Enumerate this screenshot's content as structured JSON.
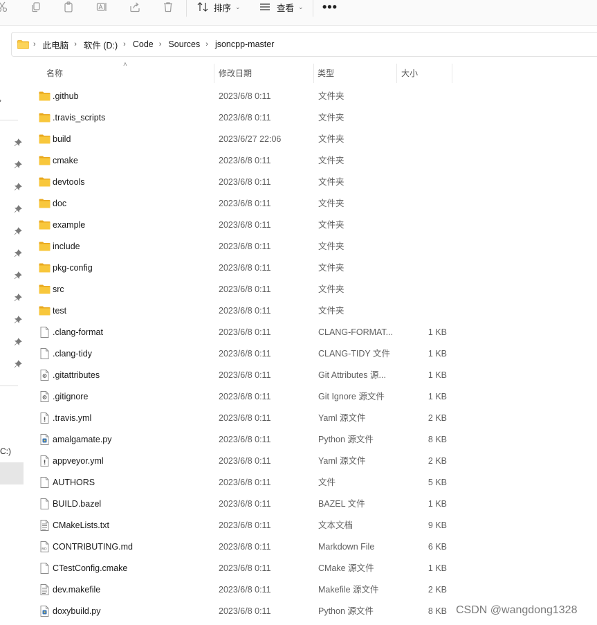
{
  "toolbar": {
    "sort_label": "排序",
    "view_label": "查看",
    "more_label": "•••"
  },
  "address": {
    "crumbs": [
      "此电脑",
      "软件 (D:)",
      "Code",
      "Sources",
      "jsoncpp-master"
    ]
  },
  "left_pane": {
    "drive_fragment": "C:)"
  },
  "columns": {
    "name": "名称",
    "date": "修改日期",
    "type": "类型",
    "size": "大小"
  },
  "files": [
    {
      "name": ".github",
      "date": "2023/6/8 0:11",
      "type": "文件夹",
      "size": "",
      "icon": "folder-icon"
    },
    {
      "name": ".travis_scripts",
      "date": "2023/6/8 0:11",
      "type": "文件夹",
      "size": "",
      "icon": "folder-icon"
    },
    {
      "name": "build",
      "date": "2023/6/27 22:06",
      "type": "文件夹",
      "size": "",
      "icon": "folder-icon"
    },
    {
      "name": "cmake",
      "date": "2023/6/8 0:11",
      "type": "文件夹",
      "size": "",
      "icon": "folder-icon"
    },
    {
      "name": "devtools",
      "date": "2023/6/8 0:11",
      "type": "文件夹",
      "size": "",
      "icon": "folder-icon"
    },
    {
      "name": "doc",
      "date": "2023/6/8 0:11",
      "type": "文件夹",
      "size": "",
      "icon": "folder-icon"
    },
    {
      "name": "example",
      "date": "2023/6/8 0:11",
      "type": "文件夹",
      "size": "",
      "icon": "folder-icon"
    },
    {
      "name": "include",
      "date": "2023/6/8 0:11",
      "type": "文件夹",
      "size": "",
      "icon": "folder-icon"
    },
    {
      "name": "pkg-config",
      "date": "2023/6/8 0:11",
      "type": "文件夹",
      "size": "",
      "icon": "folder-icon"
    },
    {
      "name": "src",
      "date": "2023/6/8 0:11",
      "type": "文件夹",
      "size": "",
      "icon": "folder-icon"
    },
    {
      "name": "test",
      "date": "2023/6/8 0:11",
      "type": "文件夹",
      "size": "",
      "icon": "folder-icon"
    },
    {
      "name": ".clang-format",
      "date": "2023/6/8 0:11",
      "type": "CLANG-FORMAT...",
      "size": "1 KB",
      "icon": "file-icon"
    },
    {
      "name": ".clang-tidy",
      "date": "2023/6/8 0:11",
      "type": "CLANG-TIDY 文件",
      "size": "1 KB",
      "icon": "file-icon"
    },
    {
      "name": ".gitattributes",
      "date": "2023/6/8 0:11",
      "type": "Git Attributes 源...",
      "size": "1 KB",
      "icon": "gear-file-icon"
    },
    {
      "name": ".gitignore",
      "date": "2023/6/8 0:11",
      "type": "Git Ignore 源文件",
      "size": "1 KB",
      "icon": "gear-file-icon"
    },
    {
      "name": ".travis.yml",
      "date": "2023/6/8 0:11",
      "type": "Yaml 源文件",
      "size": "2 KB",
      "icon": "yaml-file-icon"
    },
    {
      "name": "amalgamate.py",
      "date": "2023/6/8 0:11",
      "type": "Python 源文件",
      "size": "8 KB",
      "icon": "python-file-icon"
    },
    {
      "name": "appveyor.yml",
      "date": "2023/6/8 0:11",
      "type": "Yaml 源文件",
      "size": "2 KB",
      "icon": "yaml-file-icon"
    },
    {
      "name": "AUTHORS",
      "date": "2023/6/8 0:11",
      "type": "文件",
      "size": "5 KB",
      "icon": "file-icon"
    },
    {
      "name": "BUILD.bazel",
      "date": "2023/6/8 0:11",
      "type": "BAZEL 文件",
      "size": "1 KB",
      "icon": "file-icon"
    },
    {
      "name": "CMakeLists.txt",
      "date": "2023/6/8 0:11",
      "type": "文本文档",
      "size": "9 KB",
      "icon": "text-file-icon"
    },
    {
      "name": "CONTRIBUTING.md",
      "date": "2023/6/8 0:11",
      "type": "Markdown File",
      "size": "6 KB",
      "icon": "markdown-file-icon"
    },
    {
      "name": "CTestConfig.cmake",
      "date": "2023/6/8 0:11",
      "type": "CMake 源文件",
      "size": "1 KB",
      "icon": "file-icon"
    },
    {
      "name": "dev.makefile",
      "date": "2023/6/8 0:11",
      "type": "Makefile 源文件",
      "size": "2 KB",
      "icon": "text-file-icon"
    },
    {
      "name": "doxybuild.py",
      "date": "2023/6/8 0:11",
      "type": "Python 源文件",
      "size": "8 KB",
      "icon": "python-file-icon"
    }
  ],
  "watermark": "CSDN @wangdong1328",
  "colors": {
    "folder": "#f8c73c",
    "folder_dark": "#e9a81e",
    "python": "#3a76b7",
    "icon_gray": "#9a9a9a"
  }
}
